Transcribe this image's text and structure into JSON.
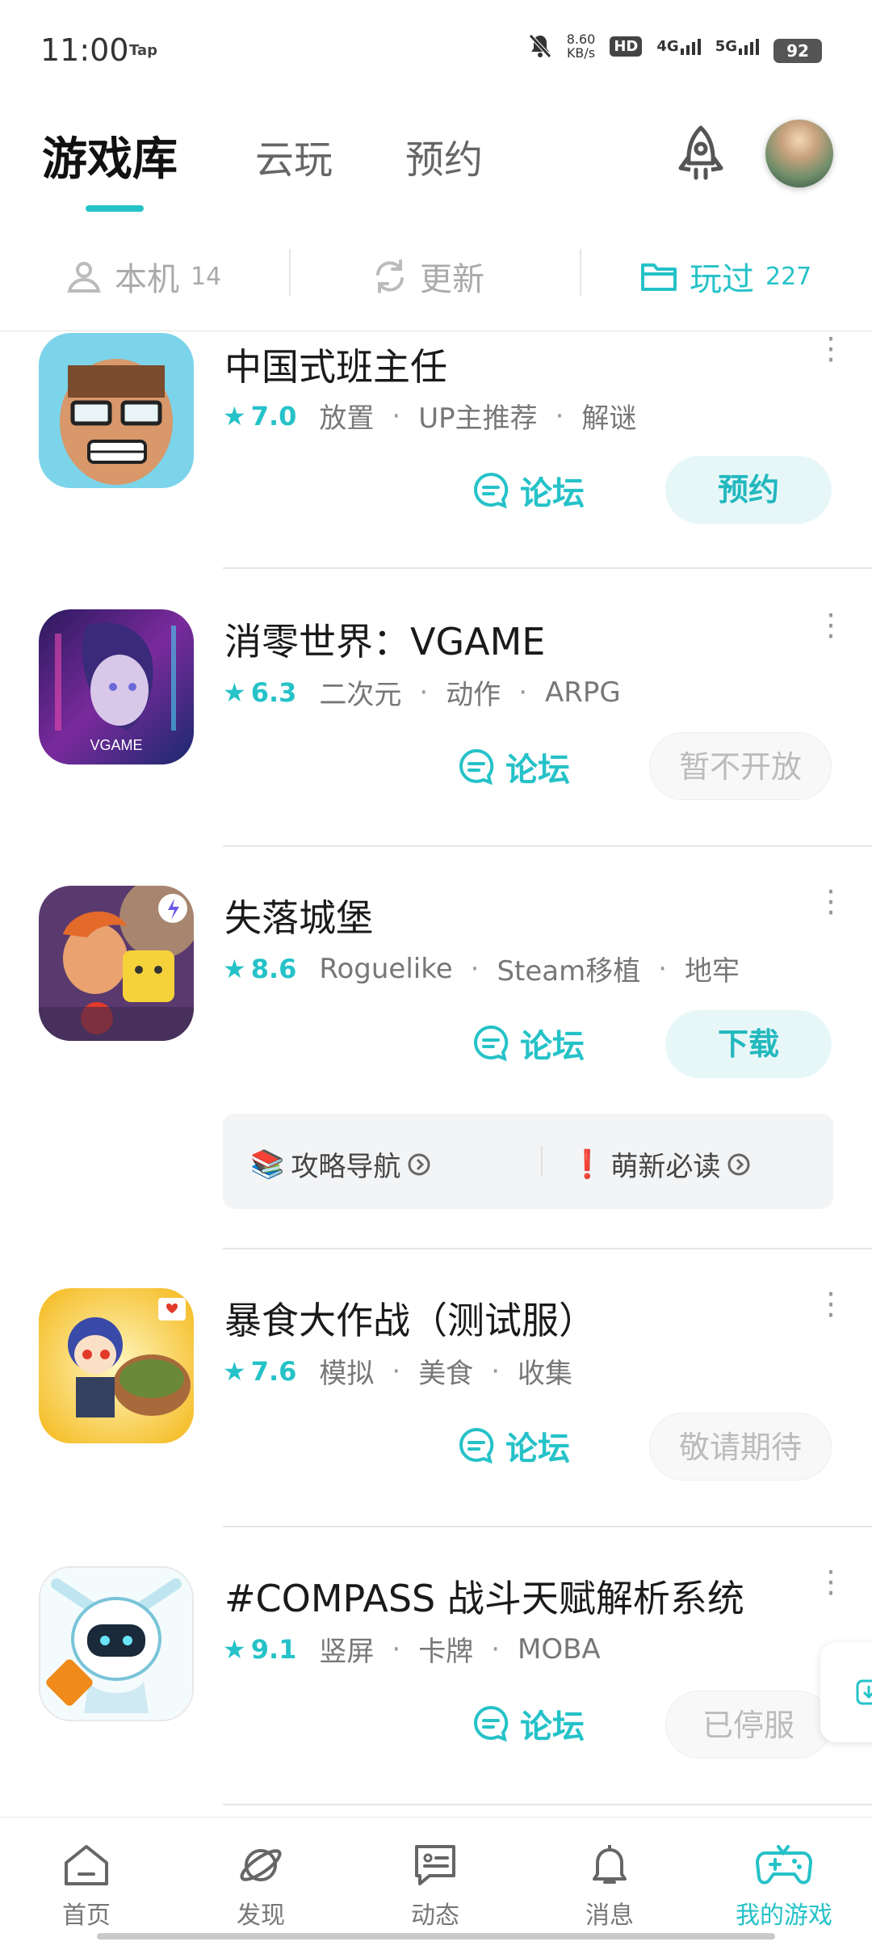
{
  "status": {
    "time": "11:00",
    "app_tag": "Tap",
    "speed_value": "8.60",
    "speed_unit": "KB/s",
    "hd": "HD",
    "sim1": "4G",
    "sim2": "5G",
    "battery": "92"
  },
  "header": {
    "tabs": [
      "游戏库",
      "云玩",
      "预约"
    ],
    "active_tab": 0
  },
  "filters": {
    "local_label": "本机",
    "local_count": "14",
    "update_label": "更新",
    "played_label": "玩过",
    "played_count": "227"
  },
  "games": [
    {
      "title": "中国式班主任",
      "rating": "7.0",
      "tags": [
        "放置",
        "UP主推荐",
        "解谜"
      ],
      "forum_label": "论坛",
      "action_label": "预约",
      "action_style": "primary"
    },
    {
      "title": "消零世界：VGAME",
      "rating": "6.3",
      "tags": [
        "二次元",
        "动作",
        "ARPG"
      ],
      "forum_label": "论坛",
      "action_label": "暂不开放",
      "action_style": "disabled",
      "icon_text": "VGAME"
    },
    {
      "title": "失落城堡",
      "rating": "8.6",
      "tags": [
        "Roguelike",
        "Steam移植",
        "地牢"
      ],
      "forum_label": "论坛",
      "action_label": "下载",
      "action_style": "primary",
      "guide": [
        {
          "emoji": "📚",
          "label": "攻略导航"
        },
        {
          "emoji": "❗",
          "label": "萌新必读"
        }
      ]
    },
    {
      "title": "暴食大作战（测试服）",
      "rating": "7.6",
      "tags": [
        "模拟",
        "美食",
        "收集"
      ],
      "forum_label": "论坛",
      "action_label": "敬请期待",
      "action_style": "disabled"
    },
    {
      "title": "#COMPASS 战斗天赋解析系统",
      "rating": "9.1",
      "tags": [
        "竖屏",
        "卡牌",
        "MOBA"
      ],
      "forum_label": "论坛",
      "action_label": "已停服",
      "action_style": "disabled"
    }
  ],
  "nav": [
    "首页",
    "发现",
    "动态",
    "消息",
    "我的游戏"
  ],
  "nav_active": 4,
  "colors": {
    "accent": "#25c2c8",
    "text": "#1a1a1a",
    "muted": "#777777"
  }
}
